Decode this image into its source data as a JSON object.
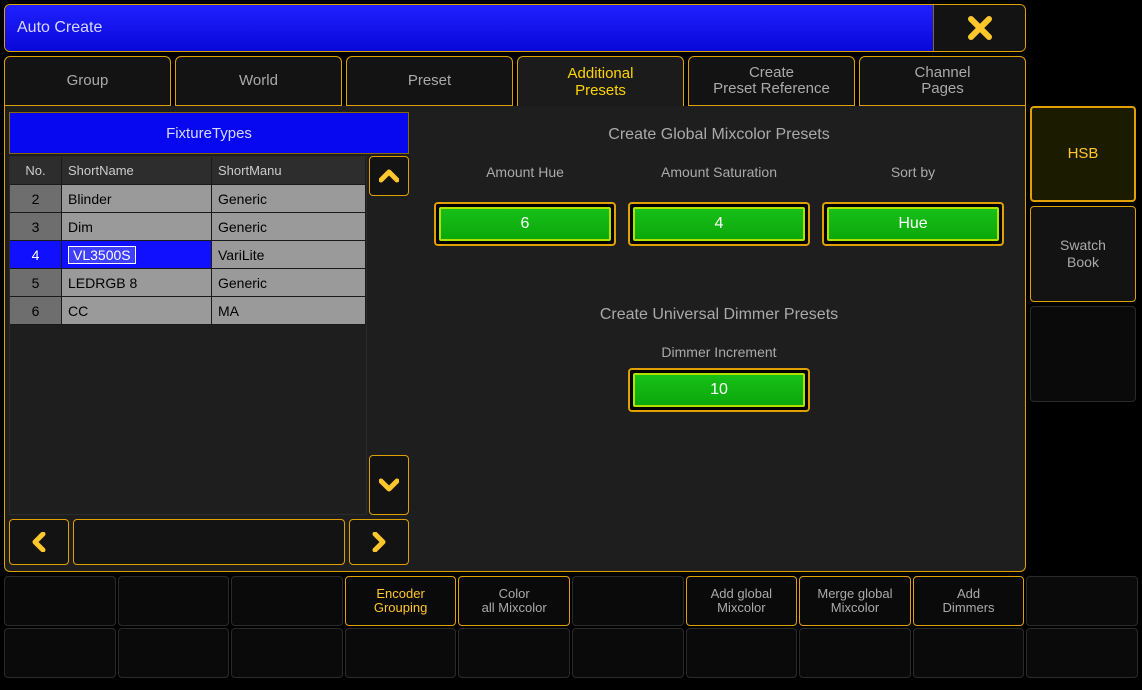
{
  "window": {
    "title": "Auto Create"
  },
  "tabs": [
    {
      "label": "Group"
    },
    {
      "label": "World"
    },
    {
      "label": "Preset"
    },
    {
      "label": "Additional\nPresets"
    },
    {
      "label": "Create\nPreset Reference"
    },
    {
      "label": "Channel\nPages"
    }
  ],
  "fixture_table": {
    "title": "FixtureTypes",
    "columns": {
      "no": "No.",
      "short_name": "ShortName",
      "short_manu": "ShortManu"
    },
    "rows": [
      {
        "no": "2",
        "name": "Blinder",
        "manu": "Generic"
      },
      {
        "no": "3",
        "name": "Dim",
        "manu": "Generic"
      },
      {
        "no": "4",
        "name": "VL3500S",
        "manu": "VariLite"
      },
      {
        "no": "5",
        "name": "LEDRGB 8",
        "manu": "Generic"
      },
      {
        "no": "6",
        "name": "CC",
        "manu": "MA"
      }
    ],
    "selected_index": 2
  },
  "mixcolor": {
    "title": "Create Global Mixcolor Presets",
    "params": [
      {
        "label": "Amount Hue",
        "value": "6"
      },
      {
        "label": "Amount Saturation",
        "value": "4"
      },
      {
        "label": "Sort by",
        "value": "Hue"
      }
    ]
  },
  "dimmer": {
    "title": "Create Universal Dimmer Presets",
    "param_label": "Dimmer Increment",
    "value": "10"
  },
  "side_buttons": [
    {
      "label": "HSB",
      "active": true
    },
    {
      "label": "Swatch\nBook",
      "active": false
    },
    {
      "label": "",
      "active": false,
      "blank": true
    }
  ],
  "softkeys": {
    "row1": [
      "",
      "",
      "",
      "Encoder\nGrouping",
      "Color\nall Mixcolor",
      "",
      "Add global\nMixcolor",
      "Merge global\nMixcolor",
      "Add\nDimmers",
      ""
    ],
    "row2": [
      "",
      "",
      "",
      "",
      "",
      "",
      "",
      "",
      "",
      ""
    ]
  }
}
